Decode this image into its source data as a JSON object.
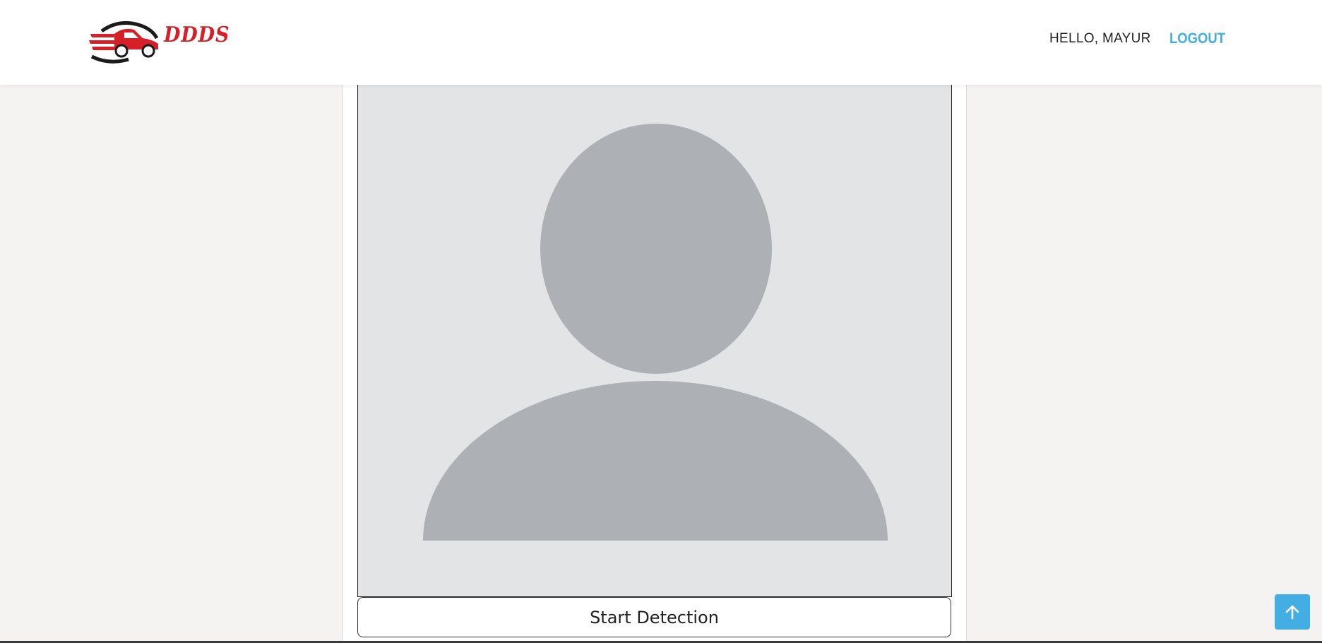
{
  "header": {
    "logo_text": "DDDS",
    "greeting": "HELLO, MAYUR",
    "logout_label": "LOGOUT"
  },
  "main": {
    "placeholder_icon": "user-avatar-placeholder-icon",
    "start_button_label": "Start Detection"
  },
  "scroll_top": {
    "icon": "arrow-up-icon"
  },
  "colors": {
    "brand_red": "#d61f26",
    "accent_blue": "#42aee4",
    "avatar_bg": "#e3e4e6",
    "avatar_fill": "#adb1b5",
    "page_bg": "#f5f2f2"
  }
}
